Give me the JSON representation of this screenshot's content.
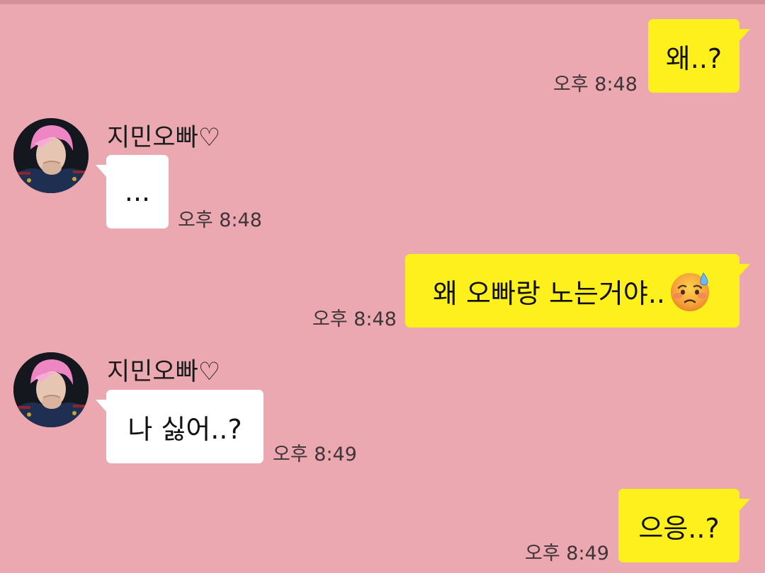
{
  "chat": {
    "sender_name": "지민오빠♡",
    "messages": [
      {
        "direction": "out",
        "text": "왜..?",
        "time": "오후 8:48"
      },
      {
        "direction": "in",
        "text": "...",
        "time": "오후 8:48"
      },
      {
        "direction": "out",
        "text": "왜 오빠랑 노는거야..",
        "emoji": "sad-sweat-face-emoji",
        "time": "오후 8:48"
      },
      {
        "direction": "in",
        "text": "나 싫어..?",
        "time": "오후 8:49"
      },
      {
        "direction": "out",
        "text": "으응..?",
        "time": "오후 8:49"
      }
    ]
  },
  "colors": {
    "background": "#eca8b1",
    "outgoing_bubble": "#fef01c",
    "incoming_bubble": "#ffffff"
  }
}
